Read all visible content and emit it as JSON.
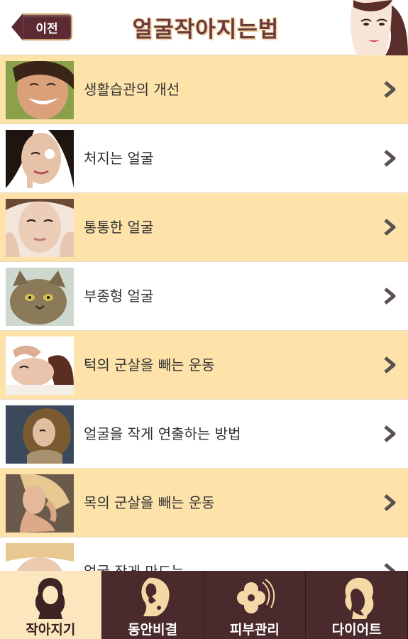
{
  "header": {
    "back_label": "이전",
    "title": "얼굴작아지는법"
  },
  "list": {
    "items": [
      {
        "label": "생활습관의 개선",
        "thumb": "smiling-woman-photo"
      },
      {
        "label": "처지는 얼굴",
        "thumb": "woman-face-cream-photo"
      },
      {
        "label": "통통한 얼굴",
        "thumb": "woman-hands-face-photo"
      },
      {
        "label": "부종형 얼굴",
        "thumb": "cat-photo"
      },
      {
        "label": "턱의 군살을 빼는 운동",
        "thumb": "woman-facial-massage-photo"
      },
      {
        "label": "얼굴을 작게 연출하는 방법",
        "thumb": "curly-hair-woman-photo"
      },
      {
        "label": "목의 군살을 빼는 운동",
        "thumb": "woman-neck-photo"
      },
      {
        "label": "얼굴 작게 만드는",
        "thumb": "woman-towel-photo"
      }
    ]
  },
  "tabs": [
    {
      "label": "작아지기",
      "icon": "woman-silhouette-icon",
      "active": true
    },
    {
      "label": "동안비결",
      "icon": "woman-profile-icon",
      "active": false
    },
    {
      "label": "피부관리",
      "icon": "flower-icon",
      "active": false
    },
    {
      "label": "다이어트",
      "icon": "woman-curly-hair-icon",
      "active": false
    }
  ],
  "colors": {
    "row_alt": "#fde2aa",
    "tabbar": "#4a2a2c",
    "tab_active": "#fbe6bd",
    "back_button": "#5b2a32"
  }
}
